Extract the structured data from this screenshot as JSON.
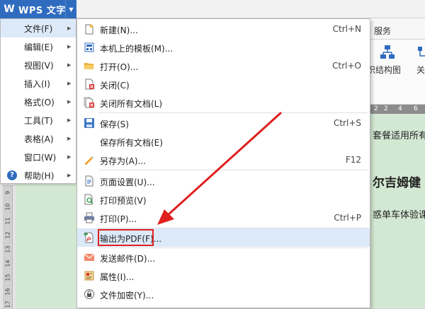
{
  "app": {
    "name": "WPS 文字",
    "logo": "W"
  },
  "menu_tabs": {
    "services": "服务"
  },
  "ribbon": {
    "orgchart_label": "织结构图",
    "more_label": "关"
  },
  "ruler": {
    "h_numbers": [
      "2",
      "2",
      "4",
      "6"
    ],
    "v_numbers": [
      "9",
      "10",
      "11",
      "12",
      "13",
      "14",
      "15",
      "16",
      "17"
    ]
  },
  "document": {
    "line1": "套餐适用所有",
    "line2": "尔吉姆健",
    "line3": "惑单车体验课"
  },
  "main_menu": [
    {
      "label": "文件(F)",
      "active": true
    },
    {
      "label": "编辑(E)"
    },
    {
      "label": "视图(V)"
    },
    {
      "label": "插入(I)"
    },
    {
      "label": "格式(O)"
    },
    {
      "label": "工具(T)"
    },
    {
      "label": "表格(A)"
    },
    {
      "label": "窗口(W)"
    },
    {
      "label": "帮助(H)",
      "icon": "help-icon"
    }
  ],
  "file_menu": [
    {
      "label": "新建(N)...",
      "shortcut": "Ctrl+N",
      "icon": "new-document-icon"
    },
    {
      "label": "本机上的模板(M)...",
      "shortcut": "",
      "icon": "template-icon"
    },
    {
      "label": "打开(O)...",
      "shortcut": "Ctrl+O",
      "icon": "folder-open-icon"
    },
    {
      "label": "关闭(C)",
      "shortcut": "",
      "icon": "close-document-icon"
    },
    {
      "label": "关闭所有文档(L)",
      "shortcut": "",
      "icon": "close-all-documents-icon"
    },
    {
      "label": "保存(S)",
      "shortcut": "Ctrl+S",
      "icon": "save-icon"
    },
    {
      "label": "保存所有文档(E)",
      "shortcut": "",
      "icon": ""
    },
    {
      "label": "另存为(A)...",
      "shortcut": "F12",
      "icon": "save-as-icon"
    },
    {
      "label": "页面设置(U)...",
      "shortcut": "",
      "icon": "page-setup-icon"
    },
    {
      "label": "打印预览(V)",
      "shortcut": "",
      "icon": "print-preview-icon"
    },
    {
      "label": "打印(P)...",
      "shortcut": "Ctrl+P",
      "icon": "print-icon"
    },
    {
      "label": "输出为PDF(F)...",
      "shortcut": "",
      "icon": "pdf-export-icon",
      "highlighted": true
    },
    {
      "label": "发送邮件(D)...",
      "shortcut": "",
      "icon": "mail-icon"
    },
    {
      "label": "属性(I)...",
      "shortcut": "",
      "icon": "properties-icon"
    },
    {
      "label": "文件加密(Y)...",
      "shortcut": "",
      "icon": "encrypt-icon"
    }
  ],
  "colors": {
    "wps_blue": "#2f6cbf",
    "annotation_red": "#e02020",
    "menu_highlight": "#dce9f8",
    "doc_background": "#d3e8d2"
  }
}
